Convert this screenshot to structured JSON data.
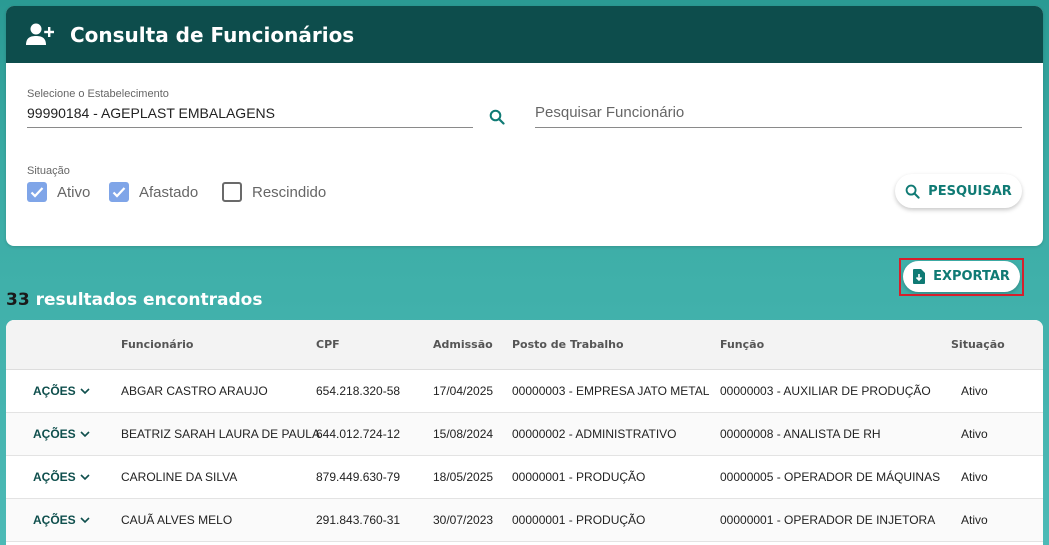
{
  "header": {
    "title": "Consulta de Funcionários",
    "icon": "add-user-icon"
  },
  "filters": {
    "establishment_label": "Selecione o Estabelecimento",
    "establishment_value": "99990184 - AGEPLAST EMBALAGENS",
    "employee_search_placeholder": "Pesquisar Funcionário",
    "situation_label": "Situação",
    "situations": [
      {
        "label": "Ativo",
        "checked": true
      },
      {
        "label": "Afastado",
        "checked": true
      },
      {
        "label": "Rescindido",
        "checked": false
      }
    ],
    "search_button_label": "PESQUISAR"
  },
  "export_button_label": "EXPORTAR",
  "results": {
    "count": "33",
    "suffix": "resultados encontrados"
  },
  "table": {
    "columns": [
      "Funcionário",
      "CPF",
      "Admissão",
      "Posto de Trabalho",
      "Função",
      "Situação"
    ],
    "actions_label": "AÇÕES",
    "rows": [
      {
        "name": "ABGAR CASTRO ARAUJO",
        "cpf": "654.218.320-58",
        "admission": "17/04/2025",
        "post": "00000003 - EMPRESA JATO METAL",
        "role": "00000003 - AUXILIAR DE PRODUÇÃO",
        "status": "Ativo"
      },
      {
        "name": "BEATRIZ SARAH LAURA DE PAULA",
        "cpf": "644.012.724-12",
        "admission": "15/08/2024",
        "post": "00000002 - ADMINISTRATIVO",
        "role": "00000008 - ANALISTA DE RH",
        "status": "Ativo"
      },
      {
        "name": "CAROLINE DA SILVA",
        "cpf": "879.449.630-79",
        "admission": "18/05/2025",
        "post": "00000001 - PRODUÇÃO",
        "role": "00000005 - OPERADOR DE MÁQUINAS",
        "status": "Ativo"
      },
      {
        "name": "CAUÃ ALVES MELO",
        "cpf": "291.843.760-31",
        "admission": "30/07/2023",
        "post": "00000001 - PRODUÇÃO",
        "role": "00000001 - OPERADOR DE INJETORA",
        "status": "Ativo"
      }
    ]
  },
  "colors": {
    "header_bg": "#0d4d4c",
    "accent": "#0f7a74",
    "checkbox": "#7fa5e8",
    "highlight": "#d61f2c"
  }
}
